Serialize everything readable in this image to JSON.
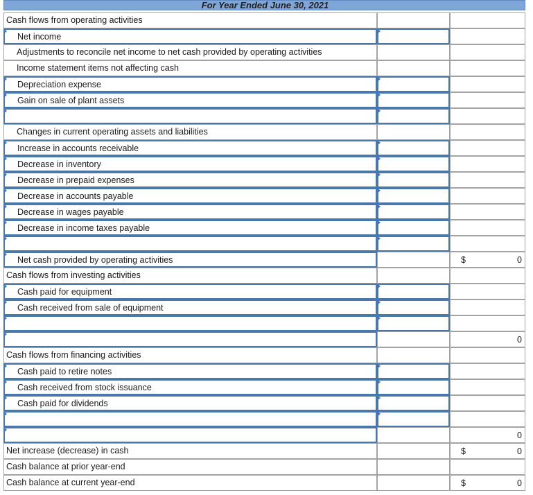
{
  "header": {
    "title": "For Year Ended June 30, 2021"
  },
  "rows": [
    {
      "label": "Cash flows from operating activities",
      "indent": 0,
      "label_input": false,
      "amount_input": false,
      "currency": "",
      "total": ""
    },
    {
      "label": "Net income",
      "indent": 1,
      "label_input": true,
      "amount_input": true,
      "currency": "",
      "total": ""
    },
    {
      "label": "Adjustments to reconcile net income to net cash provided by operating activities",
      "indent": 1,
      "label_input": false,
      "amount_input": false,
      "currency": "",
      "total": ""
    },
    {
      "label": "Income statement items not affecting cash",
      "indent": 1,
      "label_input": false,
      "amount_input": false,
      "currency": "",
      "total": ""
    },
    {
      "label": "Depreciation expense",
      "indent": 1,
      "label_input": true,
      "amount_input": true,
      "currency": "",
      "total": ""
    },
    {
      "label": "Gain on sale of plant assets",
      "indent": 1,
      "label_input": true,
      "amount_input": true,
      "currency": "",
      "total": ""
    },
    {
      "label": "",
      "indent": 1,
      "label_input": true,
      "amount_input": true,
      "currency": "",
      "total": ""
    },
    {
      "label": "Changes in current operating assets and liabilities",
      "indent": 1,
      "label_input": false,
      "amount_input": false,
      "currency": "",
      "total": ""
    },
    {
      "label": "Increase in accounts receivable",
      "indent": 1,
      "label_input": true,
      "amount_input": true,
      "currency": "",
      "total": ""
    },
    {
      "label": "Decrease in inventory",
      "indent": 1,
      "label_input": true,
      "amount_input": true,
      "currency": "",
      "total": ""
    },
    {
      "label": "Decrease in prepaid expenses",
      "indent": 1,
      "label_input": true,
      "amount_input": true,
      "currency": "",
      "total": ""
    },
    {
      "label": "Decrease in accounts payable",
      "indent": 1,
      "label_input": true,
      "amount_input": true,
      "currency": "",
      "total": ""
    },
    {
      "label": "Decrease in wages payable",
      "indent": 1,
      "label_input": true,
      "amount_input": true,
      "currency": "",
      "total": ""
    },
    {
      "label": "Decrease in income taxes payable",
      "indent": 1,
      "label_input": true,
      "amount_input": true,
      "currency": "",
      "total": ""
    },
    {
      "label": "",
      "indent": 1,
      "label_input": true,
      "amount_input": true,
      "currency": "",
      "total": ""
    },
    {
      "label": "Net cash provided by operating activities",
      "indent": 1,
      "label_input": true,
      "amount_input": false,
      "currency": "$",
      "total": "0"
    },
    {
      "label": "Cash flows from investing activities",
      "indent": 0,
      "label_input": false,
      "amount_input": false,
      "currency": "",
      "total": ""
    },
    {
      "label": "Cash paid for equipment",
      "indent": 1,
      "label_input": true,
      "amount_input": true,
      "currency": "",
      "total": ""
    },
    {
      "label": "Cash received from sale of equipment",
      "indent": 1,
      "label_input": true,
      "amount_input": true,
      "currency": "",
      "total": ""
    },
    {
      "label": "",
      "indent": 1,
      "label_input": true,
      "amount_input": true,
      "currency": "",
      "total": ""
    },
    {
      "label": "",
      "indent": 0,
      "label_input": true,
      "amount_input": false,
      "currency": "",
      "total": "0"
    },
    {
      "label": "Cash flows from financing activities",
      "indent": 0,
      "label_input": false,
      "amount_input": false,
      "currency": "",
      "total": ""
    },
    {
      "label": "Cash paid to retire notes",
      "indent": 1,
      "label_input": true,
      "amount_input": true,
      "currency": "",
      "total": ""
    },
    {
      "label": "Cash received from stock issuance",
      "indent": 1,
      "label_input": true,
      "amount_input": true,
      "currency": "",
      "total": ""
    },
    {
      "label": "Cash paid for dividends",
      "indent": 1,
      "label_input": true,
      "amount_input": true,
      "currency": "",
      "total": ""
    },
    {
      "label": "",
      "indent": 1,
      "label_input": true,
      "amount_input": true,
      "currency": "",
      "total": ""
    },
    {
      "label": "",
      "indent": 0,
      "label_input": true,
      "amount_input": false,
      "currency": "",
      "total": "0"
    },
    {
      "label": "Net increase (decrease) in cash",
      "indent": 0,
      "label_input": false,
      "amount_input": false,
      "currency": "$",
      "total": "0"
    },
    {
      "label": "Cash balance at prior year-end",
      "indent": 0,
      "label_input": false,
      "amount_input": false,
      "currency": "",
      "total": ""
    },
    {
      "label": "Cash balance at current year-end",
      "indent": 0,
      "label_input": false,
      "amount_input": false,
      "currency": "$",
      "total": "0"
    }
  ]
}
